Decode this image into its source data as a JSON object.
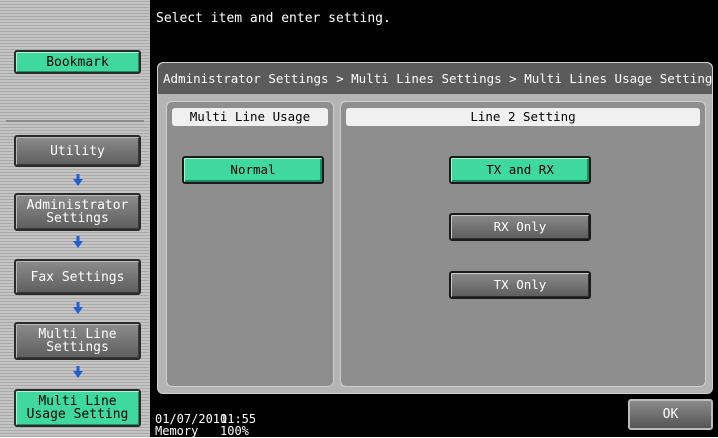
{
  "message": "Select item and enter setting.",
  "breadcrumb": "Administrator Settings > Multi Lines Settings > Multi Lines Usage Settings",
  "sidebar": {
    "bookmark": "Bookmark",
    "items": [
      {
        "label": "Utility"
      },
      {
        "label": "Administrator\nSettings"
      },
      {
        "label": "Fax Settings"
      },
      {
        "label": "Multi Line\nSettings"
      },
      {
        "label": "Multi Line\nUsage Setting"
      }
    ]
  },
  "multi_line_usage": {
    "header": "Multi Line Usage",
    "options": [
      {
        "label": "Normal",
        "selected": true
      }
    ]
  },
  "line2_setting": {
    "header": "Line 2 Setting",
    "options": [
      {
        "label": "TX and RX",
        "selected": true
      },
      {
        "label": "RX Only",
        "selected": false
      },
      {
        "label": "TX Only",
        "selected": false
      }
    ]
  },
  "status": {
    "date": "01/07/2010",
    "time": "11:55",
    "memory_label": "Memory",
    "memory_value": "100%"
  },
  "ok_label": "OK",
  "colors": {
    "active_green": "#3fd99f",
    "arrow_blue": "#1f5fd0"
  }
}
